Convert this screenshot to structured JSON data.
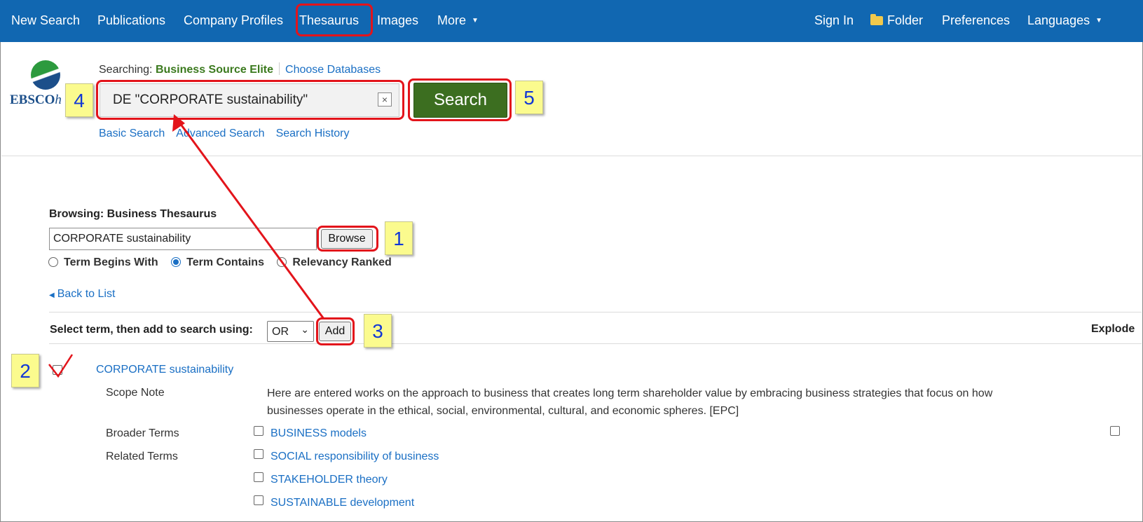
{
  "nav": {
    "left": [
      "New Search",
      "Publications",
      "Company Profiles",
      "Thesaurus",
      "Images",
      "More"
    ],
    "right": {
      "sign_in": "Sign In",
      "folder": "Folder",
      "preferences": "Preferences",
      "languages": "Languages"
    }
  },
  "header": {
    "logo_text": "EBSCO",
    "logo_text_italic": "h",
    "searching_label": "Searching:",
    "database": "Business Source Elite",
    "choose_databases": "Choose Databases",
    "search_value": "DE \"CORPORATE sustainability\"",
    "clear_label": "×",
    "search_button": "Search",
    "links": [
      "Basic Search",
      "Advanced Search",
      "Search History"
    ]
  },
  "browse": {
    "title": "Browsing: Business Thesaurus",
    "input_value": "CORPORATE sustainability",
    "browse_button": "Browse",
    "radio_options": [
      "Term Begins With",
      "Term Contains",
      "Relevancy Ranked"
    ],
    "selected_option": "Term Contains",
    "back_link": "Back to List"
  },
  "results": {
    "select_label": "Select term, then add to search using:",
    "operator": "OR",
    "add_button": "Add",
    "explode_header": "Explode",
    "term": "CORPORATE sustainability",
    "scope_note_label": "Scope Note",
    "scope_note": "Here are entered works on the approach to business that creates long term shareholder value by embracing business strategies that focus on how businesses operate in the ethical, social, environmental, cultural, and economic spheres. [EPC]",
    "broader_label": "Broader Terms",
    "broader_terms": [
      "BUSINESS models"
    ],
    "related_label": "Related Terms",
    "related_terms": [
      "SOCIAL responsibility of business",
      "STAKEHOLDER theory",
      "SUSTAINABLE development"
    ]
  },
  "annotations": [
    "1",
    "2",
    "3",
    "4",
    "5"
  ],
  "colors": {
    "nav_bg": "#1167b1",
    "link": "#1a6fc4",
    "search_button": "#3c6e20",
    "database_name": "#3b7a1e",
    "annotation_red": "#e3141b",
    "annotation_note": "#fbfb8e",
    "annotation_number": "#1238d6"
  }
}
